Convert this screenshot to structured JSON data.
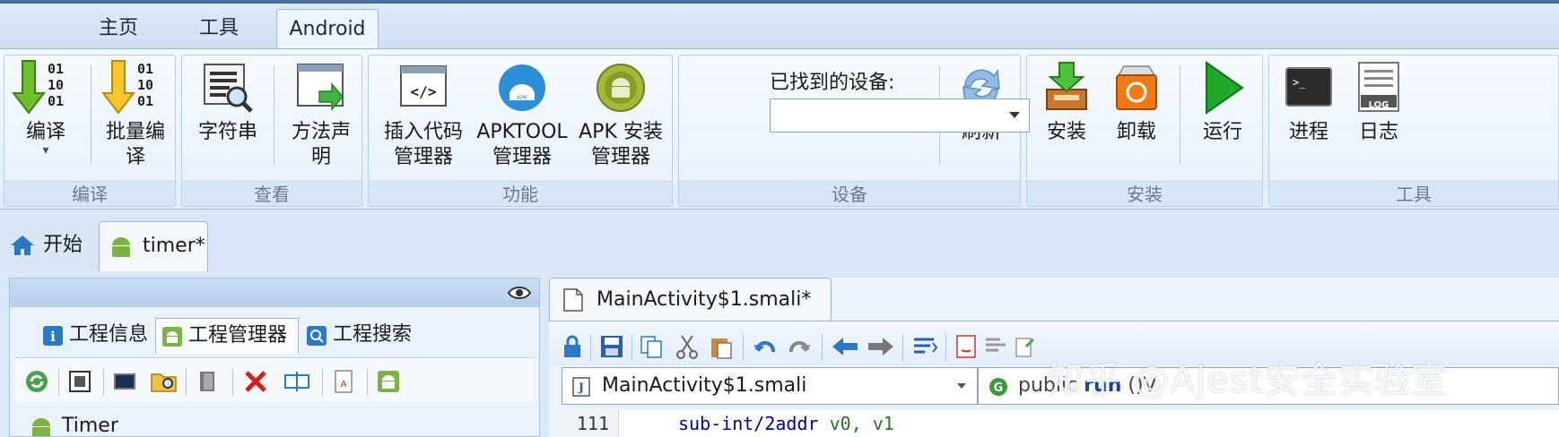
{
  "ribbon": {
    "tabs": [
      {
        "label": "主页"
      },
      {
        "label": "工具"
      },
      {
        "label": "Android"
      }
    ],
    "compile": {
      "btn1": "编译",
      "btn2a": "批量编",
      "btn2b": "译",
      "group": "编译"
    },
    "view": {
      "btn1": "字符串",
      "btn2a": "方法声",
      "btn2b": "明",
      "group": "查看"
    },
    "func": {
      "btn1a": "插入代码",
      "btn1b": "管理器",
      "btn2a": "APKTOOL",
      "btn2b": "管理器",
      "btn3a": "APK 安装",
      "btn3b": "管理器",
      "group": "功能"
    },
    "device": {
      "label": "已找到的设备:",
      "selected": "",
      "refresh": "刷新",
      "group": "设备"
    },
    "install": {
      "btn1": "安装",
      "btn2": "卸载",
      "btn3": "运行",
      "group": "安装"
    },
    "tools": {
      "btn1": "进程",
      "btn2": "日志",
      "group": "工具",
      "log_badge": "LOG"
    }
  },
  "doc_tabs": [
    {
      "label": "开始"
    },
    {
      "label": "timer*"
    }
  ],
  "left_panel": {
    "tabs": [
      {
        "label": "工程信息"
      },
      {
        "label": "工程管理器"
      },
      {
        "label": "工程搜索"
      }
    ],
    "tree": [
      {
        "label": "Timer"
      }
    ]
  },
  "editor": {
    "file_tab": "MainActivity$1.smali*",
    "class_combo": "MainActivity$1.smali",
    "method_combo_pre": "public ",
    "method_combo_kw": "run",
    "method_combo_post": " ()V",
    "line_number": "111",
    "code_op": "sub-int/2addr",
    "code_args": " v0, v1"
  },
  "watermark": "知乎 @Ajest安全实验室",
  "colors": {
    "accent": "#1e6fd0",
    "android_green": "#7cb342",
    "run_green": "#1fa82a",
    "delete_red": "#d0211b"
  }
}
